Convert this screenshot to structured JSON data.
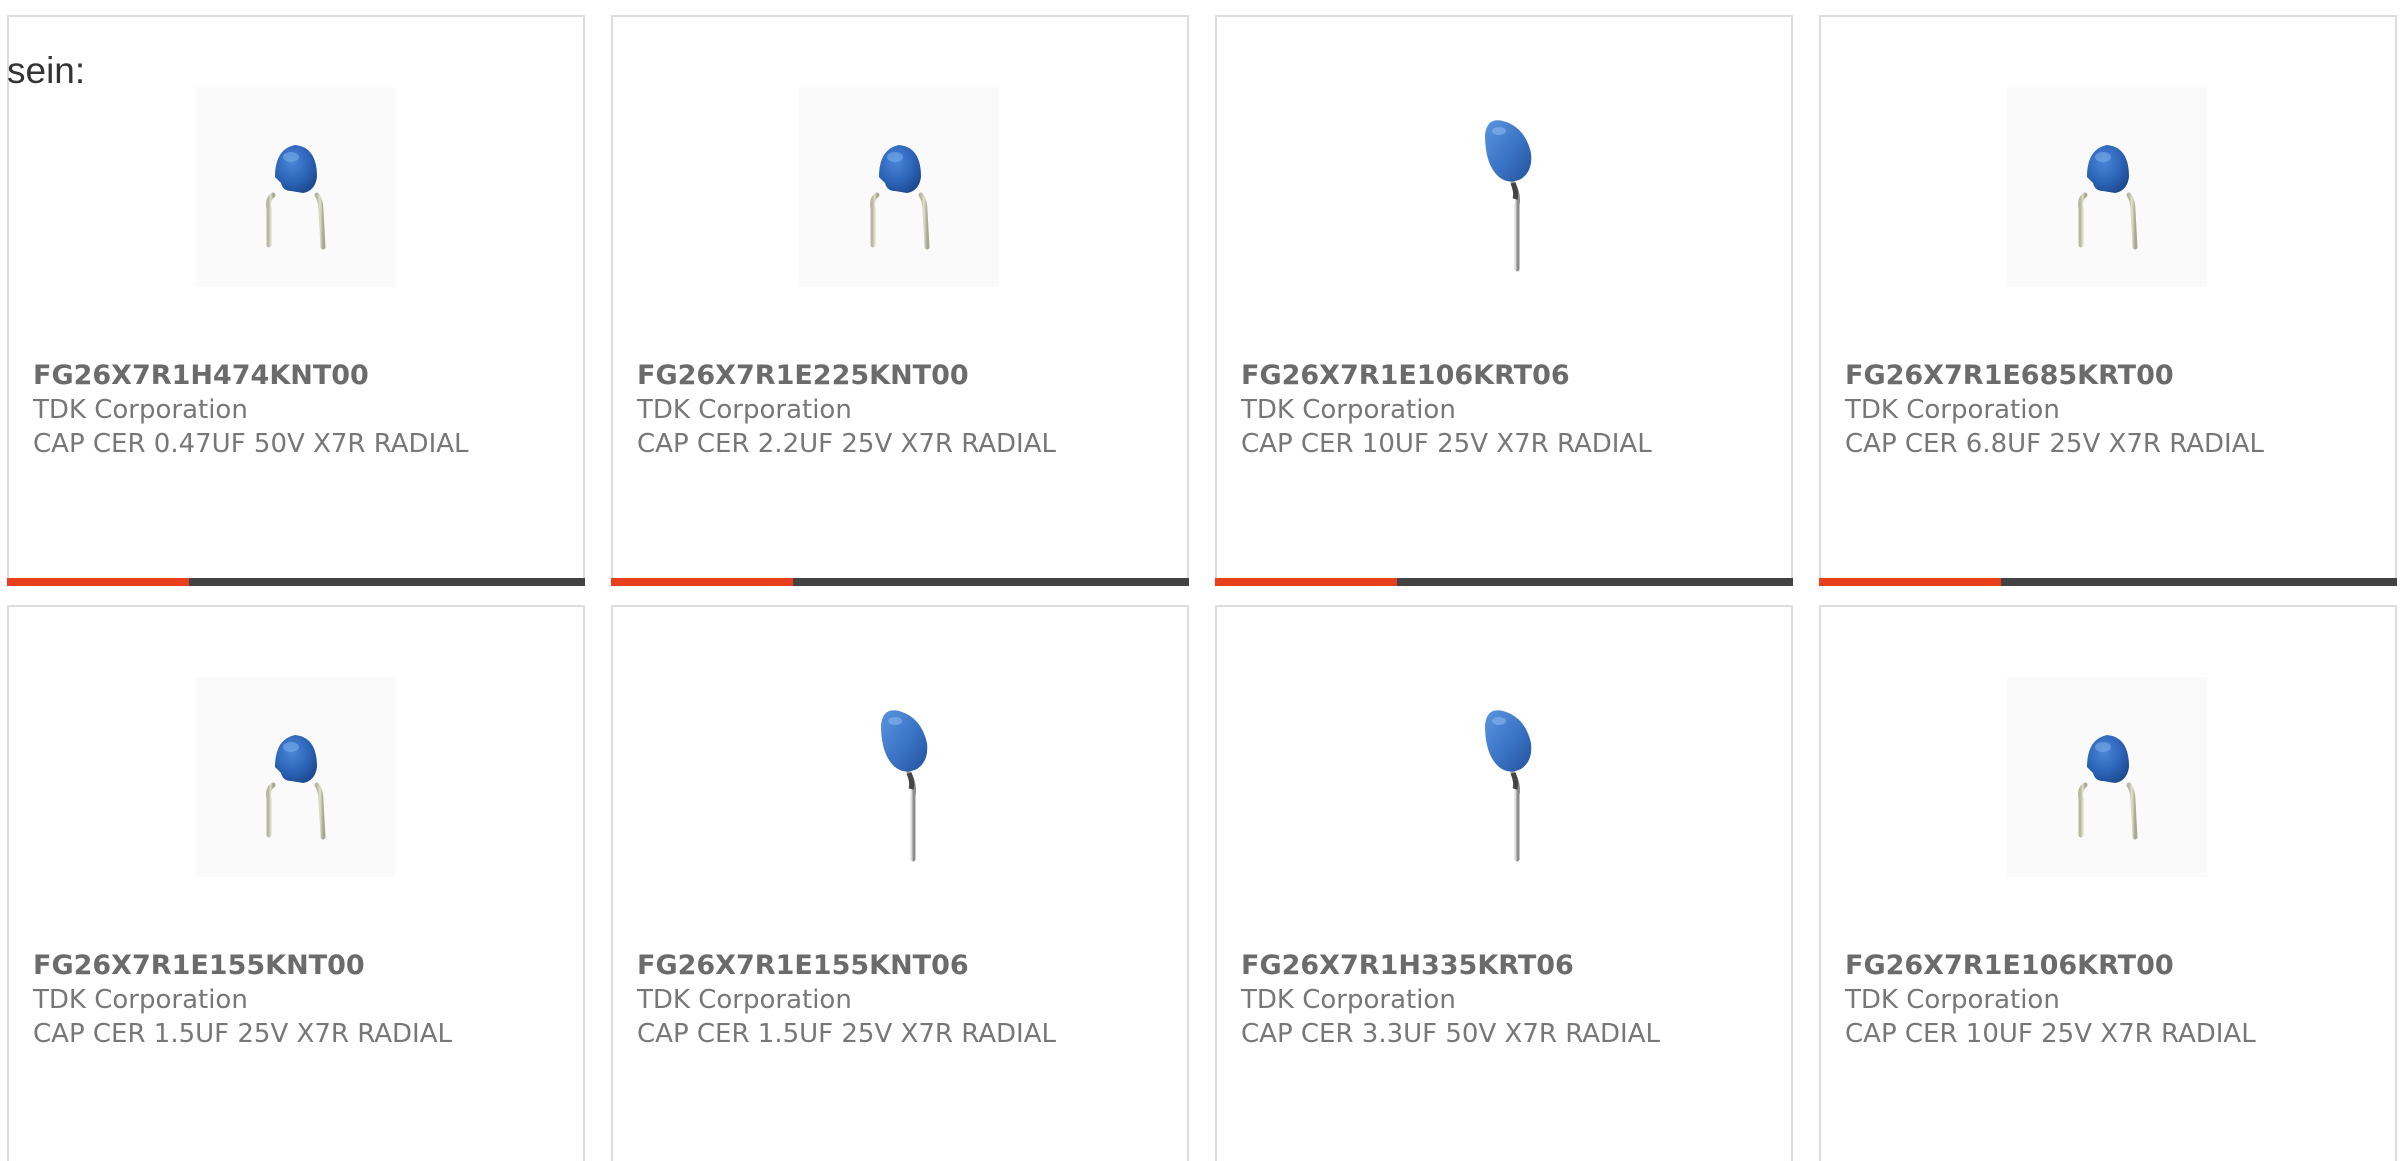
{
  "intro_text": "sein:",
  "accent_color": "#e8401c",
  "bar_color": "#424242",
  "products": [
    {
      "part_number": "FG26X7R1H474KNT00",
      "manufacturer": "TDK Corporation",
      "description": "CAP CER 0.47UF 50V X7R RADIAL",
      "image_icon": "disc-capacitor-icon"
    },
    {
      "part_number": "FG26X7R1E225KNT00",
      "manufacturer": "TDK Corporation",
      "description": "CAP CER 2.2UF 25V X7R RADIAL",
      "image_icon": "disc-capacitor-icon"
    },
    {
      "part_number": "FG26X7R1E106KRT06",
      "manufacturer": "TDK Corporation",
      "description": "CAP CER 10UF 25V X7R RADIAL",
      "image_icon": "radial-capacitor-icon"
    },
    {
      "part_number": "FG26X7R1E685KRT00",
      "manufacturer": "TDK Corporation",
      "description": "CAP CER 6.8UF 25V X7R RADIAL",
      "image_icon": "disc-capacitor-icon"
    },
    {
      "part_number": "FG26X7R1E155KNT00",
      "manufacturer": "TDK Corporation",
      "description": "CAP CER 1.5UF 25V X7R RADIAL",
      "image_icon": "disc-capacitor-icon"
    },
    {
      "part_number": "FG26X7R1E155KNT06",
      "manufacturer": "TDK Corporation",
      "description": "CAP CER 1.5UF 25V X7R RADIAL",
      "image_icon": "radial-capacitor-icon"
    },
    {
      "part_number": "FG26X7R1H335KRT06",
      "manufacturer": "TDK Corporation",
      "description": "CAP CER 3.3UF 50V X7R RADIAL",
      "image_icon": "radial-capacitor-icon"
    },
    {
      "part_number": "FG26X7R1E106KRT00",
      "manufacturer": "TDK Corporation",
      "description": "CAP CER 10UF 25V X7R RADIAL",
      "image_icon": "disc-capacitor-icon"
    }
  ]
}
